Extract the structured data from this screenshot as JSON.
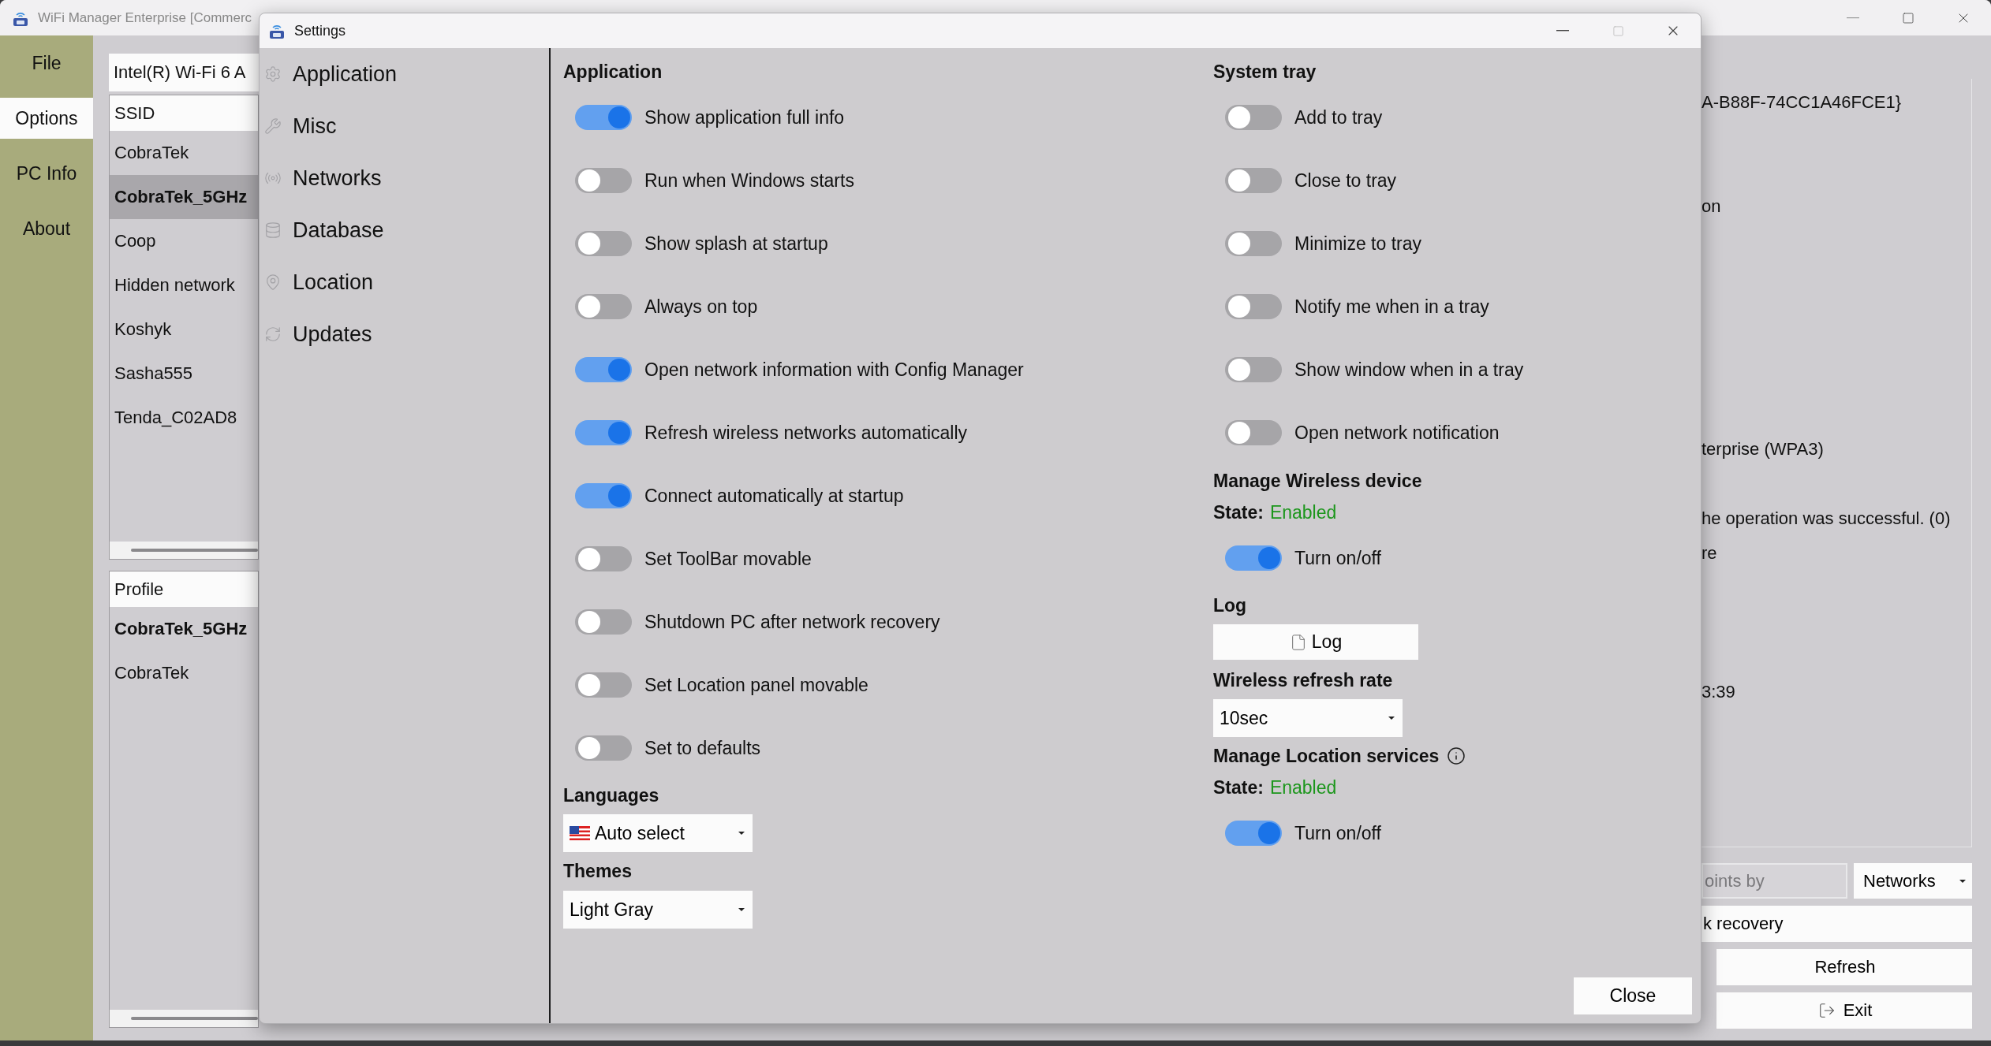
{
  "main_window": {
    "title": "WiFi Manager Enterprise [Commerc",
    "sidebar": [
      {
        "label": "File",
        "selected": false
      },
      {
        "label": "Options",
        "selected": true
      },
      {
        "label": "PC Info",
        "selected": false
      },
      {
        "label": "About",
        "selected": false
      }
    ],
    "adapter": "Intel(R) Wi-Fi 6 A",
    "ssid_list": {
      "header": "SSID",
      "rows": [
        {
          "text": "CobraTek",
          "selected": false,
          "emphasized": false
        },
        {
          "text": "CobraTek_5GHz",
          "selected": true,
          "emphasized": true
        },
        {
          "text": "Coop",
          "selected": false,
          "emphasized": false
        },
        {
          "text": "Hidden network",
          "selected": false,
          "emphasized": false
        },
        {
          "text": "Koshyk",
          "selected": false,
          "emphasized": false
        },
        {
          "text": "Sasha555",
          "selected": false,
          "emphasized": false
        },
        {
          "text": "Tenda_C02AD8",
          "selected": false,
          "emphasized": false
        }
      ]
    },
    "profile_list": {
      "header": "Profile",
      "rows": [
        {
          "text": "CobraTek_5GHz",
          "selected": false,
          "emphasized": true
        },
        {
          "text": "CobraTek",
          "selected": false,
          "emphasized": false
        }
      ]
    },
    "details": [
      "A-B88F-74CC1A46FCE1}",
      "on",
      "terprise (WPA3)",
      "he operation was successful. (0)",
      "re",
      "3:39"
    ],
    "search_field": {
      "placeholder": "oints by"
    },
    "view_select": "Networks",
    "buttons": [
      {
        "label": "k recovery",
        "kind": "plain"
      },
      {
        "label": "Refresh",
        "kind": "plain"
      },
      {
        "label": "Exit",
        "kind": "exit"
      }
    ]
  },
  "settings": {
    "title": "Settings",
    "nav": [
      {
        "label": "Application"
      },
      {
        "label": "Misc"
      },
      {
        "label": "Networks"
      },
      {
        "label": "Database"
      },
      {
        "label": "Location"
      },
      {
        "label": "Updates"
      }
    ],
    "application": {
      "heading": "Application",
      "toggles": [
        {
          "label": "Show application full info",
          "on": true
        },
        {
          "label": "Run when Windows starts",
          "on": false
        },
        {
          "label": "Show splash at startup",
          "on": false
        },
        {
          "label": "Always on top",
          "on": false
        },
        {
          "label": "Open network information with Config Manager",
          "on": true
        },
        {
          "label": "Refresh wireless networks automatically",
          "on": true
        },
        {
          "label": "Connect automatically at startup",
          "on": true
        },
        {
          "label": "Set ToolBar movable",
          "on": false
        },
        {
          "label": "Shutdown PC after network recovery",
          "on": false
        },
        {
          "label": "Set Location panel movable",
          "on": false
        },
        {
          "label": "Set to defaults",
          "on": false
        }
      ]
    },
    "languages": {
      "heading": "Languages",
      "value": "Auto select"
    },
    "themes": {
      "heading": "Themes",
      "value": "Light Gray"
    },
    "system_tray": {
      "heading": "System tray",
      "toggles": [
        {
          "label": "Add to tray",
          "on": false
        },
        {
          "label": "Close to tray",
          "on": false
        },
        {
          "label": "Minimize to tray",
          "on": false
        },
        {
          "label": "Notify me when in a tray",
          "on": false
        },
        {
          "label": "Show window when in a tray",
          "on": false
        },
        {
          "label": "Open network notification",
          "on": false
        }
      ]
    },
    "wireless_device": {
      "heading": "Manage Wireless device",
      "state_label": "State:",
      "state_value": "Enabled",
      "toggle": {
        "label": "Turn on/off",
        "on": true
      }
    },
    "log": {
      "heading": "Log",
      "button": "Log"
    },
    "refresh_rate": {
      "heading": "Wireless refresh rate",
      "value": "10sec"
    },
    "location_services": {
      "heading": "Manage Location services",
      "state_label": "State:",
      "state_value": "Enabled",
      "toggle": {
        "label": "Turn on/off",
        "on": true
      }
    },
    "close_button": "Close"
  }
}
